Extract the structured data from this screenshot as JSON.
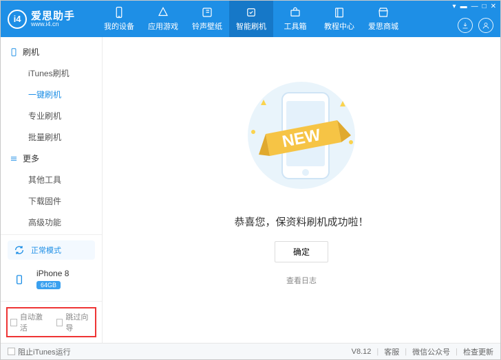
{
  "brand": {
    "name": "爱思助手",
    "url": "www.i4.cn",
    "logo_letters": "i4"
  },
  "window_controls": {
    "menu": "▾",
    "tray": "▬",
    "min": "—",
    "max": "□",
    "close": "✕"
  },
  "header_tabs": [
    {
      "label": "我的设备",
      "icon": "phone-icon"
    },
    {
      "label": "应用游戏",
      "icon": "apps-icon"
    },
    {
      "label": "铃声壁纸",
      "icon": "music-icon"
    },
    {
      "label": "智能刷机",
      "icon": "flash-icon",
      "active": true
    },
    {
      "label": "工具箱",
      "icon": "toolbox-icon"
    },
    {
      "label": "教程中心",
      "icon": "book-icon"
    },
    {
      "label": "爱思商城",
      "icon": "shop-icon"
    }
  ],
  "header_right": {
    "download": "download-icon",
    "user": "user-icon"
  },
  "sidebar": {
    "section1": {
      "title": "刷机",
      "icon": "phone-outline-icon"
    },
    "items1": [
      {
        "label": "iTunes刷机"
      },
      {
        "label": "一键刷机",
        "active": true
      },
      {
        "label": "专业刷机"
      },
      {
        "label": "批量刷机"
      }
    ],
    "section2": {
      "title": "更多",
      "icon": "more-icon"
    },
    "items2": [
      {
        "label": "其他工具"
      },
      {
        "label": "下载固件"
      },
      {
        "label": "高级功能"
      }
    ],
    "mode": {
      "label": "正常模式",
      "icon": "sync-icon"
    },
    "device": {
      "name": "iPhone 8",
      "storage": "64GB",
      "icon": "phone-solid-icon"
    },
    "bottom": {
      "auto_activate": "自动激活",
      "skip_guide": "跳过向导"
    }
  },
  "main": {
    "ribbon_text": "NEW",
    "success_msg": "恭喜您，保资料刷机成功啦！",
    "ok_btn": "确定",
    "view_log": "查看日志"
  },
  "footer": {
    "block_itunes": "阻止iTunes运行",
    "version": "V8.12",
    "support": "客服",
    "wechat": "微信公众号",
    "update": "检查更新"
  }
}
